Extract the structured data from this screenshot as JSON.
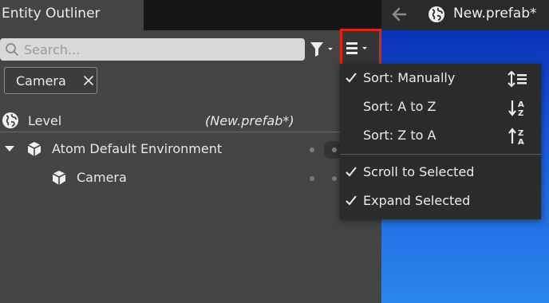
{
  "panel": {
    "title": "Entity Outliner",
    "search": {
      "placeholder": "Search...",
      "value": ""
    }
  },
  "viewport": {
    "title": "New.prefab*",
    "background_color": "#1a5fd8"
  },
  "filter_chip": {
    "label": "Camera"
  },
  "tree": {
    "level": {
      "label": "Level",
      "prefab": "(New.prefab*)"
    },
    "items": [
      {
        "label": "Atom Default Environment",
        "icon": "cube-icon",
        "expanded": true
      },
      {
        "label": "Camera",
        "icon": "cube-icon"
      }
    ]
  },
  "menu": {
    "items": [
      {
        "label": "Sort: Manually",
        "checked": true,
        "icon": "sort-manual-icon"
      },
      {
        "label": "Sort: A to Z",
        "checked": false,
        "icon": "sort-a-to-z-icon"
      },
      {
        "label": "Sort: Z to A",
        "checked": false,
        "icon": "sort-z-to-a-icon"
      },
      {
        "label": "Scroll to Selected",
        "checked": true
      },
      {
        "label": "Expand Selected",
        "checked": true
      }
    ],
    "sort_icon_letters": {
      "a": "A",
      "z": "Z"
    }
  },
  "colors": {
    "panel_bg": "#444444",
    "menu_bg": "#2b2b2b",
    "highlight_border": "#e02414",
    "search_bg": "#d9d9d9"
  }
}
